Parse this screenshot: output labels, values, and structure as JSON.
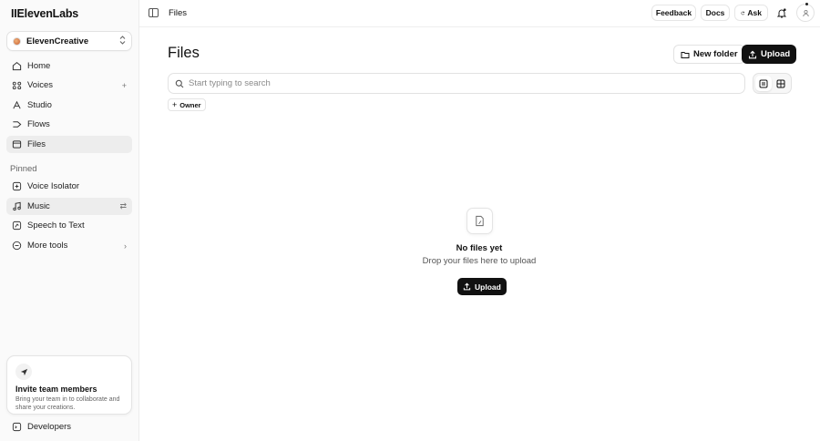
{
  "brand": {
    "logo_text": "IIElevenLabs"
  },
  "workspace": {
    "name": "ElevenCreative"
  },
  "sidebar": {
    "items": [
      {
        "label": "Home",
        "icon": "home-icon"
      },
      {
        "label": "Voices",
        "icon": "voices-icon",
        "trail": "+"
      },
      {
        "label": "Studio",
        "icon": "studio-icon"
      },
      {
        "label": "Flows",
        "icon": "flows-icon"
      },
      {
        "label": "Files",
        "icon": "files-icon",
        "active": true
      }
    ],
    "pinned_label": "Pinned",
    "pinned": [
      {
        "label": "Voice Isolator",
        "icon": "voice-isolator-icon"
      },
      {
        "label": "Music",
        "icon": "music-icon",
        "trail": "⇄"
      },
      {
        "label": "Speech to Text",
        "icon": "speech-to-text-icon"
      },
      {
        "label": "More tools",
        "icon": "more-tools-icon",
        "trail": "›"
      }
    ],
    "invite": {
      "title": "Invite team members",
      "desc": "Bring your team in to collaborate and share your creations."
    },
    "developers": "Developers"
  },
  "topbar": {
    "breadcrumb": "Files",
    "feedback": "Feedback",
    "docs": "Docs",
    "ask": "Ask"
  },
  "main": {
    "title": "Files",
    "new_folder": "New folder",
    "upload": "Upload",
    "search_placeholder": "Start typing to search",
    "filter_owner": "Owner",
    "empty": {
      "title": "No files yet",
      "subtitle": "Drop your files here to upload",
      "button": "Upload"
    }
  }
}
